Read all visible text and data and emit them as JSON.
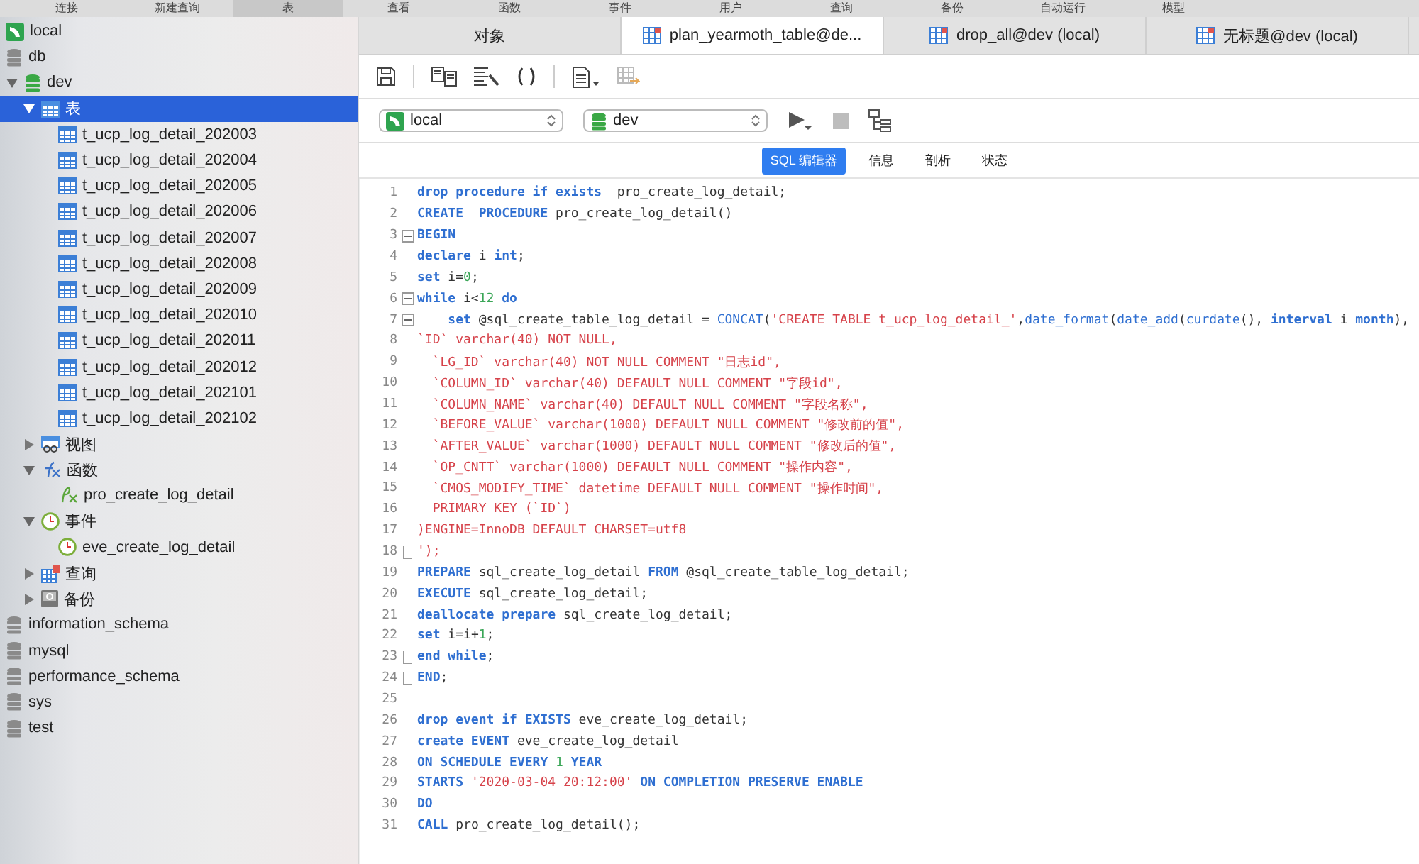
{
  "menu_bar": [
    {
      "label": "连接",
      "selected": false
    },
    {
      "label": "新建查询",
      "selected": false
    },
    {
      "label": "表",
      "selected": true
    },
    {
      "label": "查看",
      "selected": false
    },
    {
      "label": "函数",
      "selected": false
    },
    {
      "label": "事件",
      "selected": false
    },
    {
      "label": "用户",
      "selected": false
    },
    {
      "label": "查询",
      "selected": false
    },
    {
      "label": "备份",
      "selected": false
    },
    {
      "label": "自动运行",
      "selected": false
    },
    {
      "label": "模型",
      "selected": false
    }
  ],
  "sidebar": {
    "items": [
      {
        "kind": "connection",
        "label": "local",
        "selected": false
      },
      {
        "kind": "database",
        "label": "db",
        "selected": false
      },
      {
        "kind": "database-open",
        "label": "dev",
        "selected": false,
        "expanded": true,
        "children": [
          {
            "kind": "tables",
            "label": "表",
            "selected": true,
            "expanded": true,
            "children": [
              {
                "kind": "table",
                "label": "t_ucp_log_detail_202003",
                "selected": false
              },
              {
                "kind": "table",
                "label": "t_ucp_log_detail_202004",
                "selected": false
              },
              {
                "kind": "table",
                "label": "t_ucp_log_detail_202005",
                "selected": false
              },
              {
                "kind": "table",
                "label": "t_ucp_log_detail_202006",
                "selected": false
              },
              {
                "kind": "table",
                "label": "t_ucp_log_detail_202007",
                "selected": false
              },
              {
                "kind": "table",
                "label": "t_ucp_log_detail_202008",
                "selected": false
              },
              {
                "kind": "table",
                "label": "t_ucp_log_detail_202009",
                "selected": false
              },
              {
                "kind": "table",
                "label": "t_ucp_log_detail_202010",
                "selected": false
              },
              {
                "kind": "table",
                "label": "t_ucp_log_detail_202011",
                "selected": false
              },
              {
                "kind": "table",
                "label": "t_ucp_log_detail_202012",
                "selected": false
              },
              {
                "kind": "table",
                "label": "t_ucp_log_detail_202101",
                "selected": false
              },
              {
                "kind": "table",
                "label": "t_ucp_log_detail_202102",
                "selected": false
              }
            ]
          },
          {
            "kind": "views",
            "label": "视图",
            "selected": false,
            "expanded": false
          },
          {
            "kind": "functions",
            "label": "函数",
            "selected": false,
            "expanded": true,
            "children": [
              {
                "kind": "function",
                "label": "pro_create_log_detail",
                "selected": false
              }
            ]
          },
          {
            "kind": "events",
            "label": "事件",
            "selected": false,
            "expanded": true,
            "children": [
              {
                "kind": "event",
                "label": "eve_create_log_detail",
                "selected": false
              }
            ]
          },
          {
            "kind": "queries",
            "label": "查询",
            "selected": false,
            "expanded": false
          },
          {
            "kind": "backups",
            "label": "备份",
            "selected": false,
            "expanded": false
          }
        ]
      },
      {
        "kind": "database",
        "label": "information_schema",
        "selected": false
      },
      {
        "kind": "database",
        "label": "mysql",
        "selected": false
      },
      {
        "kind": "database",
        "label": "performance_schema",
        "selected": false
      },
      {
        "kind": "database",
        "label": "sys",
        "selected": false
      },
      {
        "kind": "database",
        "label": "test",
        "selected": false
      }
    ]
  },
  "tabs": [
    {
      "kind": "objects",
      "label": "对象",
      "selected": false
    },
    {
      "kind": "query",
      "label": "plan_yearmoth_table@de...",
      "selected": true
    },
    {
      "kind": "query",
      "label": "drop_all@dev (local)",
      "selected": false
    },
    {
      "kind": "query",
      "label": "无标题@dev (local)",
      "selected": false
    }
  ],
  "selectors": {
    "connection": "local",
    "database": "dev"
  },
  "editor_tabs": [
    {
      "label": "SQL 编辑器",
      "selected": true
    },
    {
      "label": "信息",
      "selected": false
    },
    {
      "label": "剖析",
      "selected": false
    },
    {
      "label": "状态",
      "selected": false
    }
  ],
  "code_lines": [
    {
      "number": "1",
      "tokens": [
        {
          "kind": "keyword",
          "text": "drop procedure if exists"
        },
        {
          "kind": "plain",
          "text": "  pro_create_log_detail;"
        }
      ]
    },
    {
      "number": "2",
      "tokens": [
        {
          "kind": "keyword",
          "text": "CREATE  PROCEDURE"
        },
        {
          "kind": "plain",
          "text": " pro_create_log_detail()"
        }
      ]
    },
    {
      "number": "3",
      "block_start": true,
      "tokens": [
        {
          "kind": "keyword",
          "text": "BEGIN"
        }
      ]
    },
    {
      "number": "4",
      "tokens": [
        {
          "kind": "keyword",
          "text": "declare"
        },
        {
          "kind": "plain",
          "text": " i "
        },
        {
          "kind": "keyword",
          "text": "int"
        },
        {
          "kind": "plain",
          "text": ";"
        }
      ]
    },
    {
      "number": "5",
      "tokens": [
        {
          "kind": "keyword",
          "text": "set"
        },
        {
          "kind": "plain",
          "text": " i="
        },
        {
          "kind": "number",
          "text": "0"
        },
        {
          "kind": "plain",
          "text": ";"
        }
      ]
    },
    {
      "number": "6",
      "block_start": true,
      "tokens": [
        {
          "kind": "keyword",
          "text": "while"
        },
        {
          "kind": "plain",
          "text": " i<"
        },
        {
          "kind": "number",
          "text": "12"
        },
        {
          "kind": "keyword",
          "text": " do"
        }
      ]
    },
    {
      "number": "7",
      "block_start": true,
      "tokens": [
        {
          "kind": "keyword",
          "text": "    set"
        },
        {
          "kind": "plain",
          "text": " @sql_create_table_log_detail = "
        },
        {
          "kind": "function",
          "text": "CONCAT"
        },
        {
          "kind": "plain",
          "text": "("
        },
        {
          "kind": "string",
          "text": "'CREATE TABLE t_ucp_log_detail_'"
        },
        {
          "kind": "plain",
          "text": ","
        },
        {
          "kind": "function",
          "text": "date_format"
        },
        {
          "kind": "plain",
          "text": "("
        },
        {
          "kind": "function",
          "text": "date_add"
        },
        {
          "kind": "plain",
          "text": "("
        },
        {
          "kind": "function",
          "text": "curdate"
        },
        {
          "kind": "plain",
          "text": "(), "
        },
        {
          "kind": "keyword",
          "text": "interval"
        },
        {
          "kind": "plain",
          "text": " i "
        },
        {
          "kind": "keyword",
          "text": "month"
        },
        {
          "kind": "plain",
          "text": "),"
        }
      ]
    },
    {
      "number": "8",
      "tokens": [
        {
          "kind": "string",
          "text": "`ID` varchar(40) NOT NULL,"
        }
      ]
    },
    {
      "number": "9",
      "tokens": [
        {
          "kind": "string",
          "text": "  `LG_ID` varchar(40) NOT NULL COMMENT \"日志id\","
        }
      ]
    },
    {
      "number": "10",
      "tokens": [
        {
          "kind": "string",
          "text": "  `COLUMN_ID` varchar(40) DEFAULT NULL COMMENT \"字段id\","
        }
      ]
    },
    {
      "number": "11",
      "tokens": [
        {
          "kind": "string",
          "text": "  `COLUMN_NAME` varchar(40) DEFAULT NULL COMMENT \"字段名称\","
        }
      ]
    },
    {
      "number": "12",
      "tokens": [
        {
          "kind": "string",
          "text": "  `BEFORE_VALUE` varchar(1000) DEFAULT NULL COMMENT \"修改前的值\","
        }
      ]
    },
    {
      "number": "13",
      "tokens": [
        {
          "kind": "string",
          "text": "  `AFTER_VALUE` varchar(1000) DEFAULT NULL COMMENT \"修改后的值\","
        }
      ]
    },
    {
      "number": "14",
      "tokens": [
        {
          "kind": "string",
          "text": "  `OP_CNTT` varchar(1000) DEFAULT NULL COMMENT \"操作内容\","
        }
      ]
    },
    {
      "number": "15",
      "tokens": [
        {
          "kind": "string",
          "text": "  `CMOS_MODIFY_TIME` datetime DEFAULT NULL COMMENT \"操作时间\","
        }
      ]
    },
    {
      "number": "16",
      "tokens": [
        {
          "kind": "string",
          "text": "  PRIMARY KEY (`ID`)"
        }
      ]
    },
    {
      "number": "17",
      "tokens": [
        {
          "kind": "string",
          "text": ")ENGINE=InnoDB DEFAULT CHARSET=utf8"
        }
      ]
    },
    {
      "number": "18",
      "block_end": true,
      "tokens": [
        {
          "kind": "string",
          "text": "');"
        }
      ]
    },
    {
      "number": "19",
      "tokens": [
        {
          "kind": "keyword",
          "text": "PREPARE"
        },
        {
          "kind": "plain",
          "text": " sql_create_log_detail "
        },
        {
          "kind": "keyword",
          "text": "FROM"
        },
        {
          "kind": "plain",
          "text": " @sql_create_table_log_detail;"
        }
      ]
    },
    {
      "number": "20",
      "tokens": [
        {
          "kind": "keyword",
          "text": "EXECUTE"
        },
        {
          "kind": "plain",
          "text": " sql_create_log_detail;"
        }
      ]
    },
    {
      "number": "21",
      "tokens": [
        {
          "kind": "keyword",
          "text": "deallocate prepare"
        },
        {
          "kind": "plain",
          "text": " sql_create_log_detail;"
        }
      ]
    },
    {
      "number": "22",
      "tokens": [
        {
          "kind": "keyword",
          "text": "set"
        },
        {
          "kind": "plain",
          "text": " i=i+"
        },
        {
          "kind": "number",
          "text": "1"
        },
        {
          "kind": "plain",
          "text": ";"
        }
      ]
    },
    {
      "number": "23",
      "block_end": true,
      "tokens": [
        {
          "kind": "keyword",
          "text": "end while"
        },
        {
          "kind": "plain",
          "text": ";"
        }
      ]
    },
    {
      "number": "24",
      "block_end": true,
      "tokens": [
        {
          "kind": "keyword",
          "text": "END"
        },
        {
          "kind": "plain",
          "text": ";"
        }
      ]
    },
    {
      "number": "25"
    },
    {
      "number": "26",
      "tokens": [
        {
          "kind": "keyword",
          "text": "drop event if EXISTS"
        },
        {
          "kind": "plain",
          "text": " eve_create_log_detail;"
        }
      ]
    },
    {
      "number": "27",
      "tokens": [
        {
          "kind": "keyword",
          "text": "create EVENT"
        },
        {
          "kind": "plain",
          "text": " eve_create_log_detail"
        }
      ]
    },
    {
      "number": "28",
      "tokens": [
        {
          "kind": "keyword",
          "text": "ON SCHEDULE EVERY "
        },
        {
          "kind": "number",
          "text": "1"
        },
        {
          "kind": "keyword",
          "text": " YEAR"
        }
      ]
    },
    {
      "number": "29",
      "tokens": [
        {
          "kind": "keyword",
          "text": "STARTS "
        },
        {
          "kind": "string",
          "text": "'2020-03-04 20:12:00'"
        },
        {
          "kind": "keyword",
          "text": " ON COMPLETION PRESERVE ENABLE"
        }
      ]
    },
    {
      "number": "30",
      "tokens": [
        {
          "kind": "keyword",
          "text": "DO"
        }
      ]
    },
    {
      "number": "31",
      "tokens": [
        {
          "kind": "keyword",
          "text": "CALL"
        },
        {
          "kind": "plain",
          "text": " pro_create_log_detail();"
        }
      ]
    }
  ]
}
